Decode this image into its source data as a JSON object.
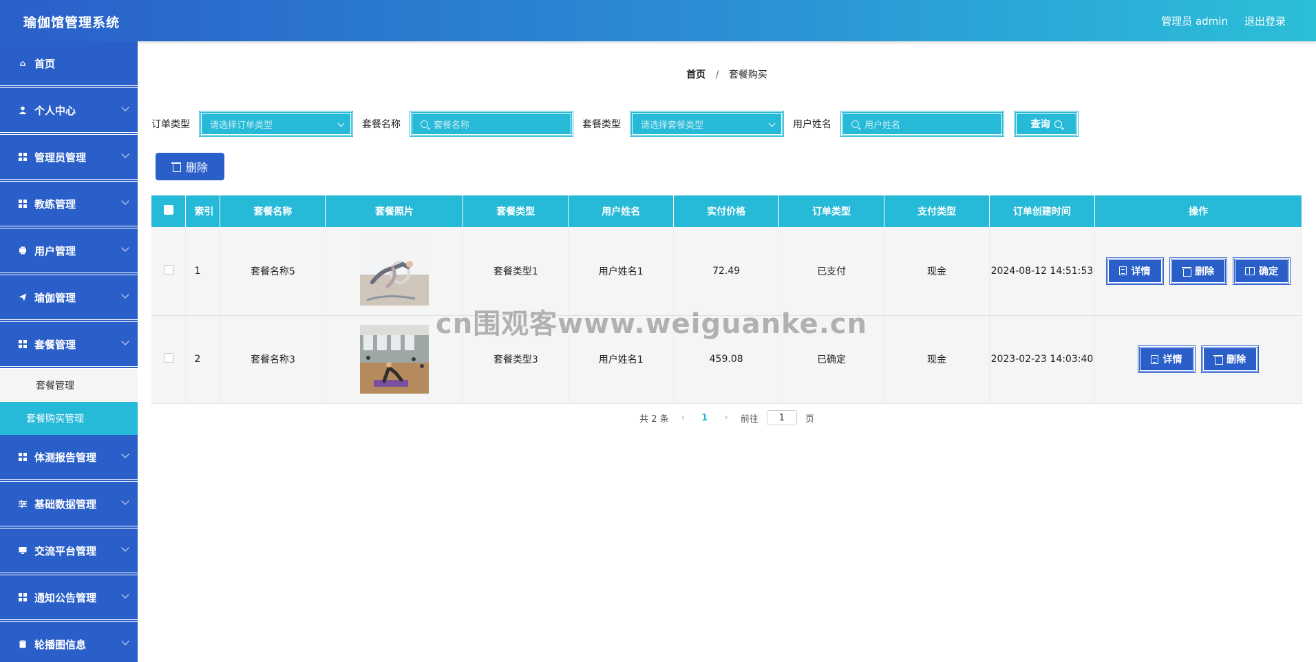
{
  "header": {
    "app_title": "瑜伽馆管理系统",
    "user_label": "管理员 admin",
    "logout_label": "退出登录"
  },
  "sidebar": {
    "items": [
      {
        "label": "首页",
        "icon": "home-icon",
        "has_chevron": false
      },
      {
        "label": "个人中心",
        "icon": "user-icon",
        "has_chevron": true
      },
      {
        "label": "管理员管理",
        "icon": "grid-icon",
        "has_chevron": true
      },
      {
        "label": "教练管理",
        "icon": "grid-icon",
        "has_chevron": true
      },
      {
        "label": "用户管理",
        "icon": "print-icon",
        "has_chevron": true
      },
      {
        "label": "瑜伽管理",
        "icon": "send-icon",
        "has_chevron": true
      },
      {
        "label": "套餐管理",
        "icon": "grid-icon",
        "has_chevron": true
      },
      {
        "label": "体测报告管理",
        "icon": "grid-icon",
        "has_chevron": true
      },
      {
        "label": "基础数据管理",
        "icon": "sliders-icon",
        "has_chevron": true
      },
      {
        "label": "交流平台管理",
        "icon": "monitor-icon",
        "has_chevron": true
      },
      {
        "label": "通知公告管理",
        "icon": "grid-icon",
        "has_chevron": true
      },
      {
        "label": "轮播图信息",
        "icon": "clipboard-icon",
        "has_chevron": true
      }
    ],
    "submenu": {
      "items": [
        "套餐管理",
        "套餐购买管理"
      ],
      "active": "套餐购买管理"
    }
  },
  "breadcrumb": {
    "home": "首页",
    "separator": "/",
    "current": "套餐购买"
  },
  "filters": {
    "order_type_label": "订单类型",
    "order_type_placeholder": "请选择订单类型",
    "package_name_label": "套餐名称",
    "package_name_placeholder": "套餐名称",
    "package_type_label": "套餐类型",
    "package_type_placeholder": "请选择套餐类型",
    "user_name_label": "用户姓名",
    "user_name_placeholder": "用户姓名",
    "query_label": "查询"
  },
  "toolbar": {
    "delete_label": "删除"
  },
  "table": {
    "columns": [
      "索引",
      "套餐名称",
      "套餐照片",
      "套餐类型",
      "用户姓名",
      "实付价格",
      "订单类型",
      "支付类型",
      "订单创建时间",
      "操作"
    ],
    "rows": [
      {
        "index": "1",
        "name": "套餐名称5",
        "type": "套餐类型1",
        "user": "用户姓名1",
        "price": "72.49",
        "order_type": "已支付",
        "pay_type": "现金",
        "created": "2024-08-12 14:51:53",
        "actions": [
          "详情",
          "删除",
          "确定"
        ]
      },
      {
        "index": "2",
        "name": "套餐名称3",
        "type": "套餐类型3",
        "user": "用户姓名1",
        "price": "459.08",
        "order_type": "已确定",
        "pay_type": "现金",
        "created": "2023-02-23 14:03:40",
        "actions": [
          "详情",
          "删除"
        ]
      }
    ]
  },
  "pagination": {
    "total": "共 2 条",
    "current_page": "1",
    "goto_label": "前往",
    "goto_value": "1",
    "page_suffix": "页"
  },
  "watermark": "cn围观客www.weiguanke.cn",
  "colors": {
    "primary": "#2a5fc9",
    "accent": "#27bad8"
  }
}
